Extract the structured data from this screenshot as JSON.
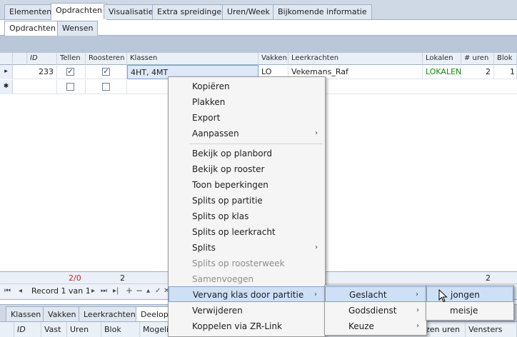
{
  "top_tabs": [
    "Elementen",
    "Opdrachten",
    "Visualisatie",
    "Extra spreidingen",
    "Uren/Week",
    "Bijkomende informatie"
  ],
  "sub_tabs": [
    "Opdrachten",
    "Wensen"
  ],
  "columns": [
    "ID",
    "Tellen",
    "Roosteren",
    "Klassen",
    "Vakken",
    "Leerkrachten",
    "Lokalen",
    "# uren",
    "Blok"
  ],
  "row1": {
    "selector": "▸",
    "id": "233",
    "tellen": "✓",
    "roosteren": "✓",
    "klassen": "4HT,  4MT",
    "vakken": "LO",
    "leerkrachten": "Vekemans_Raf",
    "lokalen": "LOKALEN",
    "uren": "2",
    "blok": "1"
  },
  "row2": {
    "selector": "✱"
  },
  "totals": {
    "count1": "2/0",
    "count2": "2",
    "count3": "2"
  },
  "nav": {
    "record_label": "Record 1 van 1",
    "first": "⏮",
    "prev": "◂",
    "next": "▸",
    "next_page": "⏭",
    "last": "▸|",
    "add": "+",
    "remove": "−",
    "up": "▴",
    "check": "✓",
    "cancel": "✕"
  },
  "bottom_tabs": [
    "Klassen",
    "Vakken",
    "Leerkrachten",
    "Deelopd"
  ],
  "bottom_cols": [
    "ID",
    "Vast",
    "Uren",
    "Blok",
    "Mogelijk",
    "zen uren",
    "Vensters"
  ],
  "context_menu": {
    "items": [
      {
        "label": "Kopiëren"
      },
      {
        "label": "Plakken"
      },
      {
        "label": "Export"
      },
      {
        "label": "Aanpassen"
      },
      {
        "label": "Bekijk op planbord"
      },
      {
        "label": "Bekijk op rooster"
      },
      {
        "label": "Toon beperkingen"
      },
      {
        "label": "Splits op partitie"
      },
      {
        "label": "Splits op klas"
      },
      {
        "label": "Splits op leerkracht"
      },
      {
        "label": "Splits"
      },
      {
        "label": "Splits op roosterweek"
      },
      {
        "label": "Samenvoegen"
      },
      {
        "label": "Vervang klas door partitie"
      },
      {
        "label": "Verwijderen"
      },
      {
        "label": "Koppelen via ZR-Link"
      }
    ],
    "arrow": "›"
  },
  "submenu1": {
    "items": [
      {
        "label": "Geslacht"
      },
      {
        "label": "Godsdienst"
      },
      {
        "label": "Keuze"
      }
    ]
  },
  "submenu2": {
    "items": [
      {
        "label": "jongen"
      },
      {
        "label": "meisje"
      }
    ]
  },
  "colors": {
    "accent": "#cfe0f6",
    "tab_bg": "#cfd9e6",
    "lokalen_text": "#138a13",
    "totals_red": "#c0282e"
  }
}
